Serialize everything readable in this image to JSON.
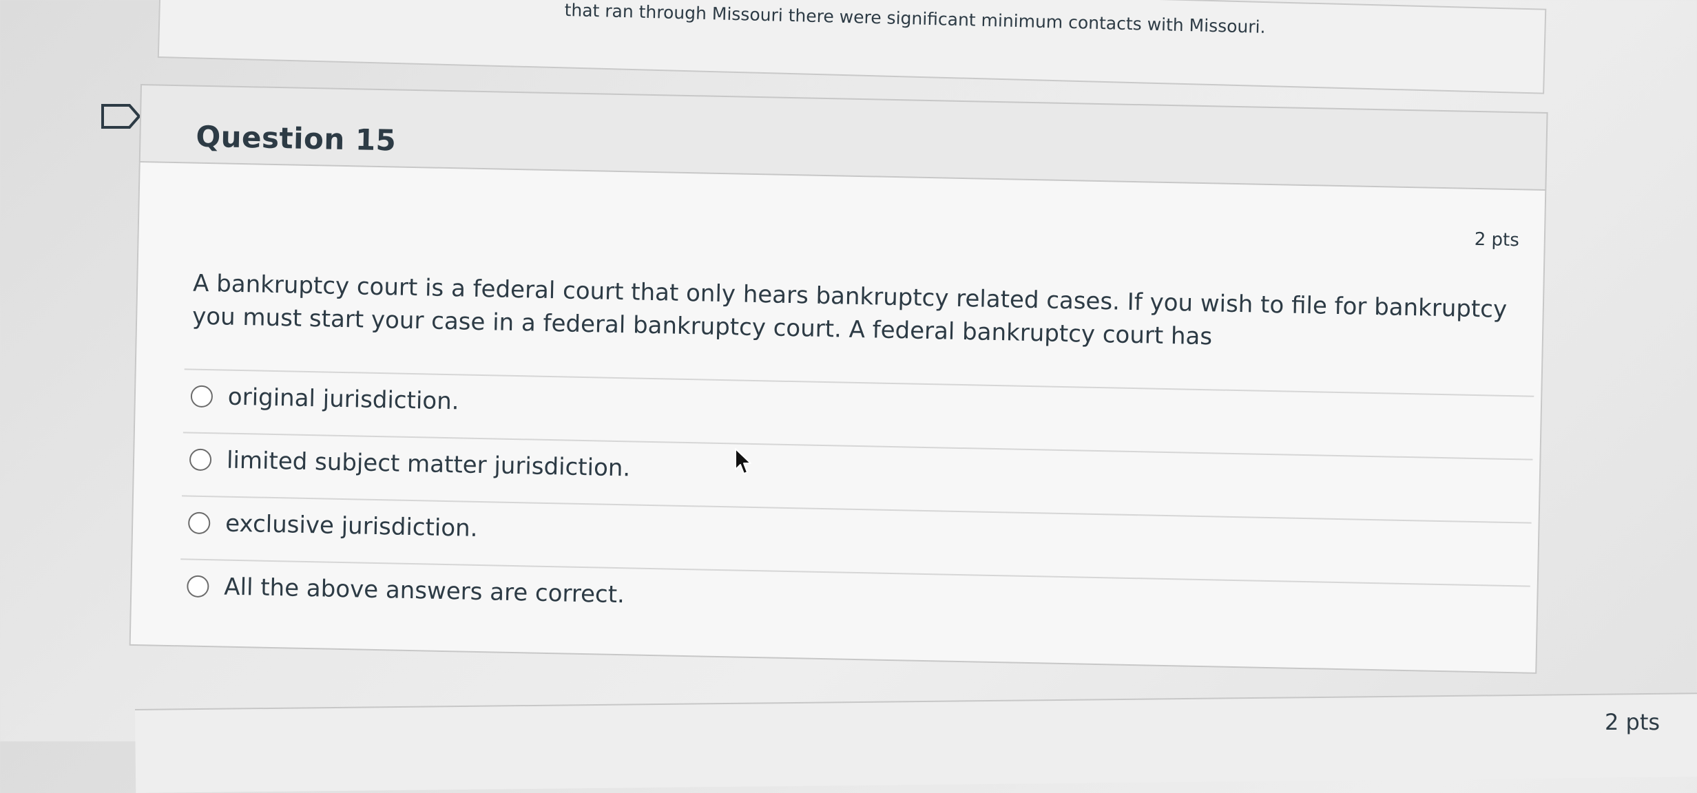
{
  "previous_question": {
    "trailing_text": "that ran through Missouri there were significant minimum contacts with Missouri."
  },
  "question": {
    "title": "Question 15",
    "points": "2 pts",
    "text": "A bankruptcy court is a federal court that only hears bankruptcy related cases.  If you wish to file for bankruptcy you must start your case in a federal bankruptcy court.  A federal bankruptcy court has",
    "answers": [
      {
        "label": "original jurisdiction.",
        "selected": false
      },
      {
        "label": "limited subject matter jurisdiction.",
        "selected": false
      },
      {
        "label": "exclusive jurisdiction.",
        "selected": false
      },
      {
        "label": "All the above answers are correct.",
        "selected": false
      }
    ]
  },
  "next_question": {
    "points": "2 pts"
  },
  "icons": {
    "flag": "flag-outline-icon",
    "cursor": "mouse-pointer-icon",
    "radio": "radio-button-icon"
  }
}
